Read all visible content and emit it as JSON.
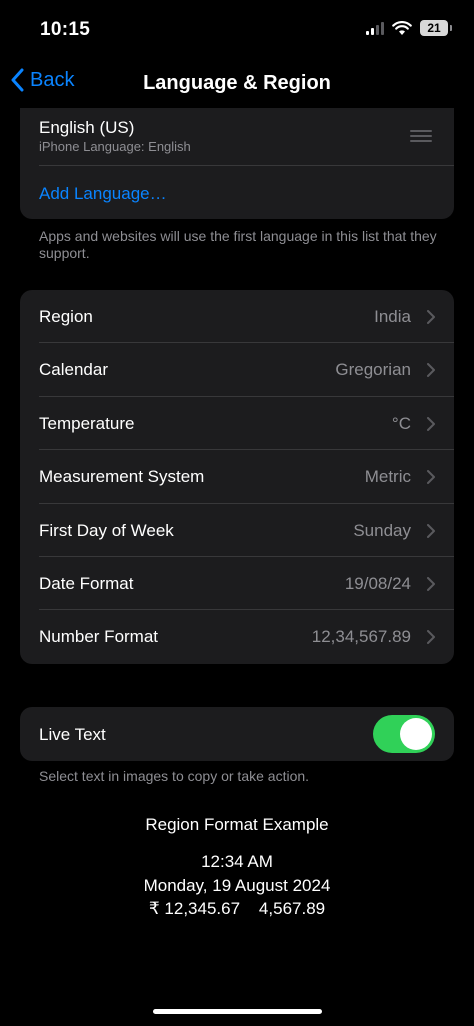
{
  "status": {
    "time": "10:15",
    "battery": "21"
  },
  "nav": {
    "back_label": "Back",
    "title": "Language & Region"
  },
  "languages": {
    "items": [
      {
        "name": "English (US)",
        "sub": "iPhone Language: English"
      }
    ],
    "add_label": "Add Language…",
    "footnote": "Apps and websites will use the first language in this list that they support."
  },
  "settings": {
    "rows": [
      {
        "label": "Region",
        "value": "India"
      },
      {
        "label": "Calendar",
        "value": "Gregorian"
      },
      {
        "label": "Temperature",
        "value": "°C"
      },
      {
        "label": "Measurement System",
        "value": "Metric"
      },
      {
        "label": "First Day of Week",
        "value": "Sunday"
      },
      {
        "label": "Date Format",
        "value": "19/08/24"
      },
      {
        "label": "Number Format",
        "value": "12,34,567.89"
      }
    ]
  },
  "live_text": {
    "label": "Live Text",
    "enabled": true,
    "footnote": "Select text in images to copy or take action."
  },
  "example": {
    "title": "Region Format Example",
    "time": "12:34 AM",
    "date": "Monday, 19 August 2024",
    "numbers": "₹ 12,345.67    4,567.89"
  },
  "colors": {
    "accent": "#0a84ff",
    "toggle_on": "#30d158",
    "group_bg": "#1c1c1e",
    "secondary_text": "#8e8e93"
  }
}
